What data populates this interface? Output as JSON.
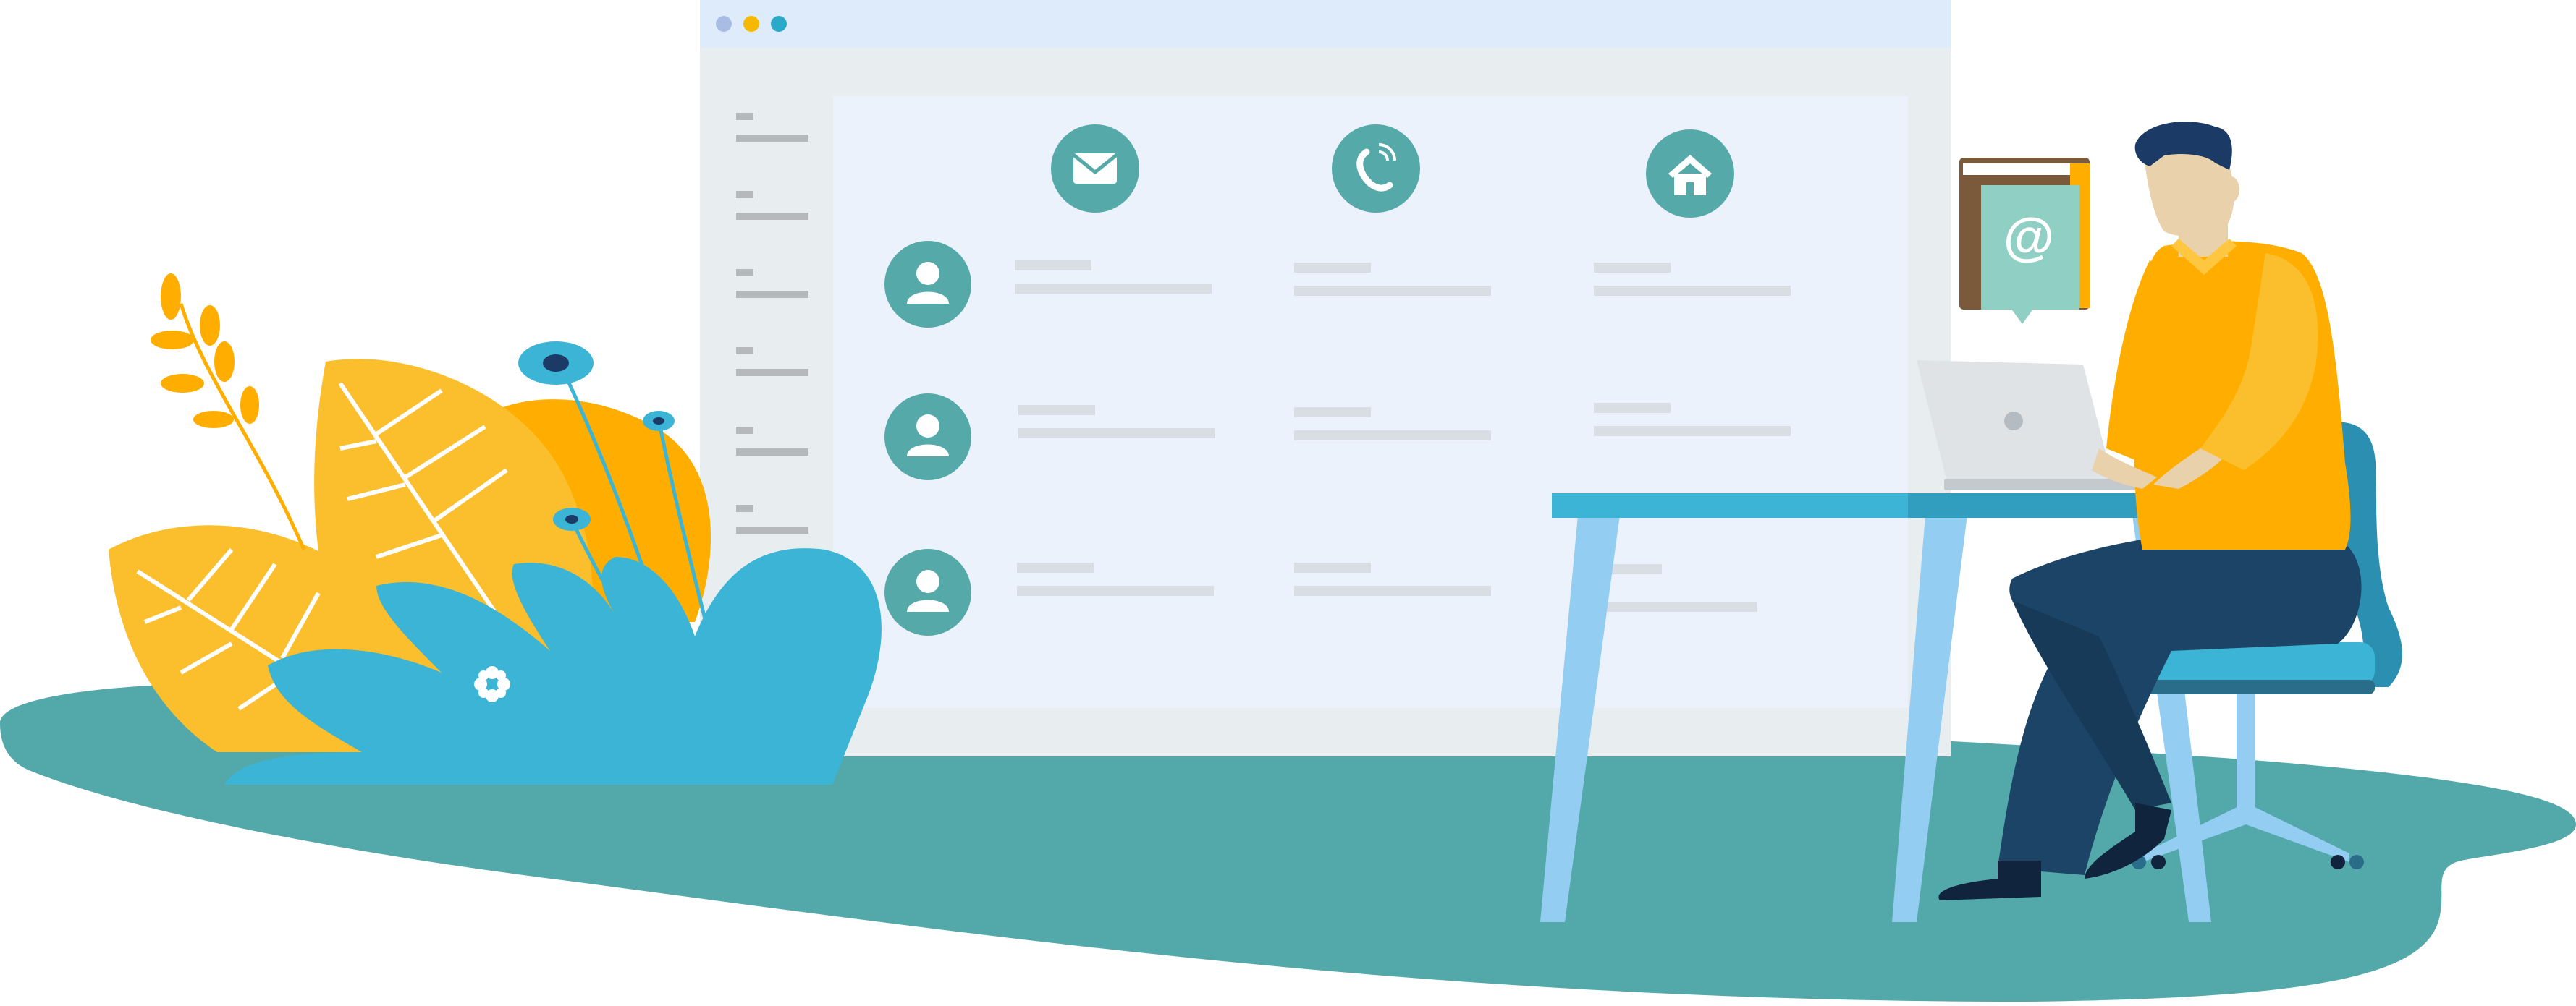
{
  "colors": {
    "background": "#ffffff",
    "ground": "#53a9a9",
    "window_frame": "#e8eef0",
    "window_titlebar": "#deebfa",
    "window_content": "#ebf2fb",
    "dot_1": "#a9bde4",
    "dot_2": "#f6b900",
    "dot_3": "#2ba9c9",
    "icon_circle": "#55aaa9",
    "placeholder_line": "#d8dee3",
    "sidebar_line": "#b5b9bc",
    "desk_top": "#3cb4d6",
    "desk_leg": "#94cdf2",
    "shirt": "#ffae00",
    "pants": "#1b4466",
    "leaf_yellow": "#fbbf2e",
    "bush_blue": "#3cb4d6",
    "book_cover": "#90cfc4",
    "book_spine": "#7b5a3b"
  },
  "window": {
    "traffic_lights": [
      "dot-1",
      "dot-2",
      "dot-3"
    ],
    "columns": [
      {
        "icon": "email-icon"
      },
      {
        "icon": "phone-icon"
      },
      {
        "icon": "home-icon"
      }
    ],
    "contacts": [
      {
        "avatar": "user-avatar-icon"
      },
      {
        "avatar": "user-avatar-icon"
      },
      {
        "avatar": "user-avatar-icon"
      }
    ],
    "sidebar_item_count": 6
  },
  "address_book": {
    "symbol": "@"
  }
}
